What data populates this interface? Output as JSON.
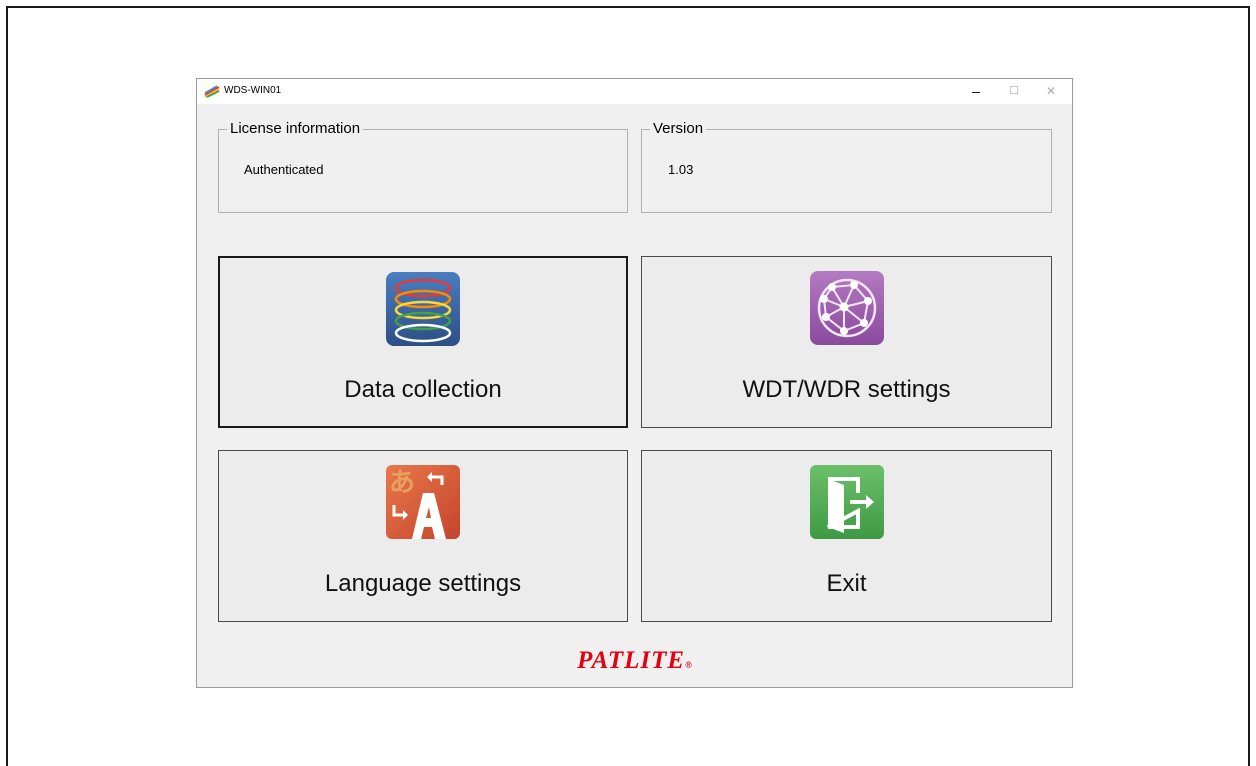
{
  "window": {
    "title": "WDS-WIN01",
    "minimize_glyph": "–",
    "maximize_glyph": "☐",
    "close_glyph": "✕"
  },
  "license": {
    "label": "License information",
    "value": "Authenticated"
  },
  "version": {
    "label": "Version",
    "value": "1.03"
  },
  "tiles": {
    "data_collection": {
      "label": "Data collection",
      "icon": "data-stack-icon",
      "focused": true
    },
    "wdt_wdr": {
      "label": "WDT/WDR settings",
      "icon": "network-globe-icon"
    },
    "language": {
      "label": "Language settings",
      "icon": "translate-icon"
    },
    "exit": {
      "label": "Exit",
      "icon": "exit-door-icon"
    }
  },
  "brand": {
    "name": "PATLITE",
    "registered": "®",
    "color": "#e4000f"
  },
  "colors": {
    "data_icon_bg": "#3a5f9a",
    "wdt_icon_bg": "#9c58ac",
    "lang_icon_bg": "#d4583a",
    "exit_icon_bg": "#4aa84a"
  }
}
